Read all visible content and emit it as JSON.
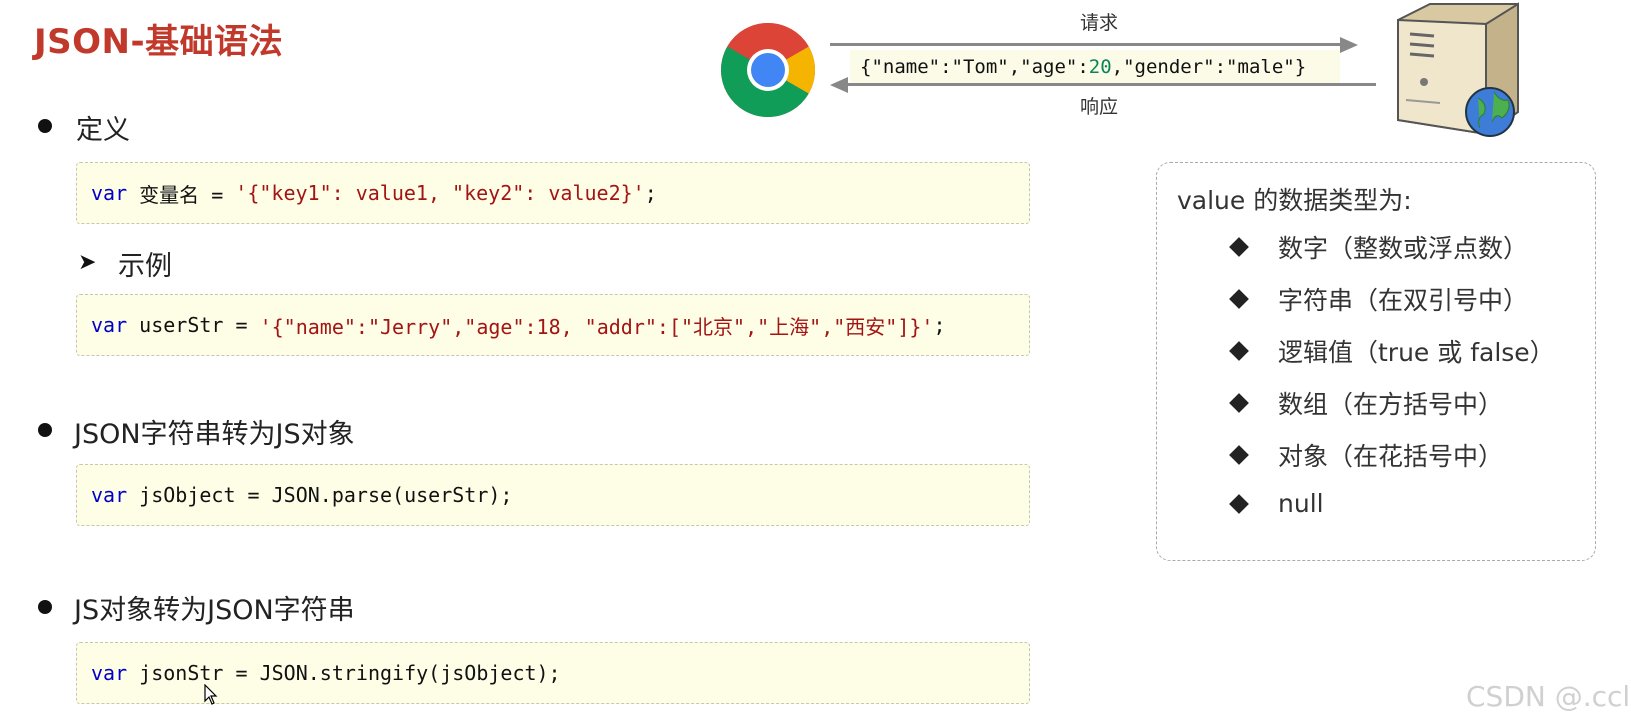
{
  "title": "JSON-基础语法",
  "sections": {
    "definition": {
      "heading": "定义",
      "code": {
        "kw": "var",
        "name": " 变量名 = ",
        "value": "'{\"key1\": value1, \"key2\": value2}'",
        "end": ";"
      },
      "example_label": "示例",
      "example_code": {
        "kw": "var",
        "name": " userStr = ",
        "value": "'{\"name\":\"Jerry\",\"age\":18, \"addr\":[\"北京\",\"上海\",\"西安\"]}'",
        "end": ";"
      }
    },
    "parse": {
      "heading": "JSON字符串转为JS对象",
      "code": {
        "kw": "var",
        "rest": " jsObject = JSON.parse(userStr);"
      }
    },
    "stringify": {
      "heading": "JS对象转为JSON字符串",
      "code": {
        "kw": "var",
        "rest": " jsonStr = JSON.stringify(jsObject);"
      }
    }
  },
  "diagram": {
    "request_label": "请求",
    "response_label": "响应",
    "json_parts": {
      "p1": "{\"name\":\"Tom\",\"age\":",
      "num": "20",
      "p2": ",\"gender\":\"male\"}"
    },
    "browser_icon": "chrome-browser-icon",
    "server_icon": "web-server-icon"
  },
  "value_types": {
    "title": "value 的数据类型为:",
    "items": [
      "数字（整数或浮点数）",
      "字符串（在双引号中）",
      "逻辑值（true 或 false）",
      "数组（在方括号中）",
      "对象（在花括号中）",
      "null"
    ]
  },
  "watermark": "CSDN @.ccl",
  "colors": {
    "title": "#c0392b",
    "keyword": "#0000c8",
    "string": "#a31515",
    "code_bg": "#fefde6"
  }
}
